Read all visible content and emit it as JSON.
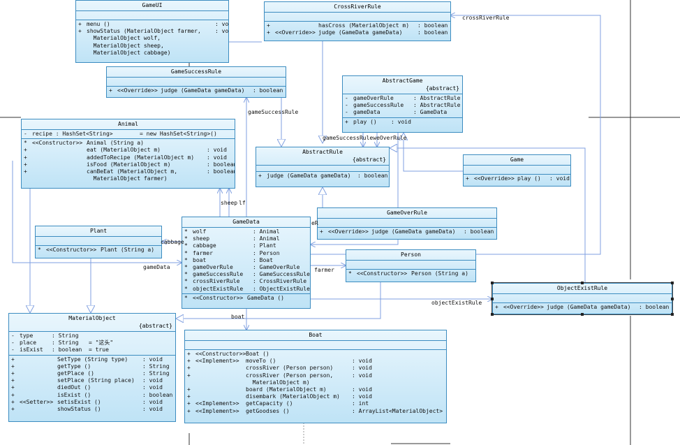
{
  "classes": {
    "gameui": {
      "name": "GameUI",
      "methods": [
        {
          "v": "+",
          "n": "menu ()",
          "t": ": void"
        },
        {
          "v": "+",
          "n": "showStatus (MaterialObject farmer,",
          "t": ": void"
        },
        {
          "v": "",
          "n": "  MaterialObject wolf,",
          "t": ""
        },
        {
          "v": "",
          "n": "  MaterialObject sheep,",
          "t": ""
        },
        {
          "v": "",
          "n": "  MaterialObject cabbage)",
          "t": ""
        }
      ]
    },
    "crossriverrule": {
      "name": "CrossRiverRule",
      "methods": [
        {
          "v": "+",
          "m": "",
          "n": "hasCross (MaterialObject m)",
          "t": ": boolean"
        },
        {
          "v": "+",
          "m": "<<Override>>",
          "n": "judge (GameData gameData)",
          "t": ": boolean"
        }
      ]
    },
    "gamesuccessrule": {
      "name": "GameSuccessRule",
      "methods": [
        {
          "v": "+",
          "m": "<<Override>>",
          "n": "judge (GameData gameData)",
          "t": ": boolean"
        }
      ]
    },
    "abstractgame": {
      "name": "AbstractGame",
      "stereo": "{abstract}",
      "attrs": [
        {
          "v": "-",
          "n": "gameOverRule",
          "t": ": AbstractRule"
        },
        {
          "v": "-",
          "n": "gameSuccessRule",
          "t": ": AbstractRule"
        },
        {
          "v": "-",
          "n": "gameData",
          "t": ": GameData"
        }
      ],
      "methods": [
        {
          "v": "+",
          "n": "play ()",
          "t": ": void"
        }
      ]
    },
    "animal": {
      "name": "Animal",
      "attrs": [
        {
          "v": "-",
          "n": "recipe : HashSet<String>",
          "t": "= new HashSet<String>()"
        }
      ],
      "methods": [
        {
          "v": "*",
          "m": "<<Constructor>>",
          "n": "Animal (String a)",
          "t": ""
        },
        {
          "v": "+",
          "m": "",
          "n": "eat (MaterialObject m)",
          "t": ": void"
        },
        {
          "v": "+",
          "m": "",
          "n": "addedToRecipe (MaterialObject m)",
          "t": ": void"
        },
        {
          "v": "+",
          "m": "",
          "n": "isFood (MaterialObject m)",
          "t": ": boolean"
        },
        {
          "v": "+",
          "m": "",
          "n": "canBeEat (MaterialObject m,",
          "t": ": boolean"
        },
        {
          "v": "",
          "m": "",
          "n": "  MaterialObject farmer)",
          "t": ""
        }
      ]
    },
    "abstractrule": {
      "name": "AbstractRule",
      "stereo": "{abstract}",
      "methods": [
        {
          "v": "+",
          "n": "judge (GameData gameData)",
          "t": ": boolean"
        }
      ]
    },
    "game": {
      "name": "Game",
      "methods": [
        {
          "v": "+",
          "m": "<<Override>>",
          "n": "play ()",
          "t": ": void"
        }
      ]
    },
    "gameoverrule": {
      "name": "GameOverRule",
      "methods": [
        {
          "v": "+",
          "m": "<<Override>>",
          "n": "judge (GameData gameData)",
          "t": ": boolean"
        }
      ]
    },
    "plant": {
      "name": "Plant",
      "methods": [
        {
          "v": "*",
          "m": "<<Constructor>>",
          "n": "Plant (String a)",
          "t": ""
        }
      ]
    },
    "gamedata": {
      "name": "GameData",
      "attrs": [
        {
          "v": "*",
          "n": "wolf",
          "t": ": Animal"
        },
        {
          "v": "*",
          "n": "sheep",
          "t": ": Animal"
        },
        {
          "v": "*",
          "n": "cabbage",
          "t": ": Plant"
        },
        {
          "v": "*",
          "n": "farmer",
          "t": ": Person"
        },
        {
          "v": "*",
          "n": "boat",
          "t": ": Boat"
        },
        {
          "v": "*",
          "n": "gameOverRule",
          "t": ": GameOverRule"
        },
        {
          "v": "*",
          "n": "gameSuccessRule",
          "t": ": GameSuccessRule"
        },
        {
          "v": "*",
          "n": "crossRiverRule",
          "t": ": CrossRiverRule"
        },
        {
          "v": "*",
          "n": "objectExistRule",
          "t": ": ObjectExistRule"
        }
      ],
      "methods": [
        {
          "v": "*",
          "m": "<<Constructor>>",
          "n": "GameData ()",
          "t": ""
        }
      ]
    },
    "person": {
      "name": "Person",
      "methods": [
        {
          "v": "*",
          "m": "<<Constructor>>",
          "n": "Person (String a)",
          "t": ""
        }
      ]
    },
    "objectexistrule": {
      "name": "ObjectExistRule",
      "methods": [
        {
          "v": "+",
          "m": "<<Override>>",
          "n": "judge (GameData gameData)",
          "t": ": boolean"
        }
      ]
    },
    "materialobject": {
      "name": "MaterialObject",
      "stereo": "{abstract}",
      "attrs": [
        {
          "v": "-",
          "n": "type",
          "t": ": String"
        },
        {
          "v": "-",
          "n": "place",
          "t": ": String   = \"这头\""
        },
        {
          "v": "-",
          "n": "isExist",
          "t": ": boolean  = true"
        }
      ],
      "methods": [
        {
          "v": "+",
          "m": "",
          "n": "SetType (String type)",
          "t": ": void"
        },
        {
          "v": "+",
          "m": "",
          "n": "getType ()",
          "t": ": String"
        },
        {
          "v": "+",
          "m": "",
          "n": "getPlace ()",
          "t": ": String"
        },
        {
          "v": "+",
          "m": "",
          "n": "setPlace (String place)",
          "t": ": void"
        },
        {
          "v": "+",
          "m": "",
          "n": "diedOut ()",
          "t": ": void"
        },
        {
          "v": "+",
          "m": "",
          "n": "isExist ()",
          "t": ": boolean"
        },
        {
          "v": "+",
          "m": "<<Setter>>",
          "n": "setisExist ()",
          "t": ": void"
        },
        {
          "v": "+",
          "m": "",
          "n": "showStatus ()",
          "t": ": void"
        }
      ]
    },
    "boat": {
      "name": "Boat",
      "methods": [
        {
          "v": "+",
          "m": "<<Constructor>>",
          "n": "Boat ()",
          "t": ""
        },
        {
          "v": "+",
          "m": "<<Implement>>",
          "n": "moveTo ()",
          "t": ": void"
        },
        {
          "v": "+",
          "m": "",
          "n": "crossRiver (Person person)",
          "t": ": void"
        },
        {
          "v": "+",
          "m": "",
          "n": "crossRiver (Person person,",
          "t": ": void"
        },
        {
          "v": "",
          "m": "",
          "n": "  MaterialObject m)",
          "t": ""
        },
        {
          "v": "+",
          "m": "",
          "n": "board (MaterialObject m)",
          "t": ": void"
        },
        {
          "v": "+",
          "m": "",
          "n": "disembark (MaterialObject m)",
          "t": ": void"
        },
        {
          "v": "+",
          "m": "<<Implement>>",
          "n": "getCapacity ()",
          "t": ": int"
        },
        {
          "v": "+",
          "m": "<<Implement>>",
          "n": "getGoodses ()",
          "t": ": ArrayList<MaterialObject>"
        }
      ]
    }
  },
  "labels": {
    "crossRiverRule": "crossRiverRule",
    "gameSuccessRule": "gameSuccessRule",
    "gameSuccessRuleOverRule": "gameSuccessRuleweOverRule",
    "sheep": "sheep",
    "wolf": "lf",
    "cabbage": "cabbage",
    "gameData": "gameData",
    "farmer": "farmer",
    "boat": "boat",
    "objectExistRule": "objectExistRule",
    "overRuleR": "eR"
  },
  "colors": {
    "classFillTop": "#e9f6fd",
    "classFillBottom": "#bfe3f6",
    "classBorder": "#3c8cc0",
    "connector": "#7f9fe0"
  }
}
